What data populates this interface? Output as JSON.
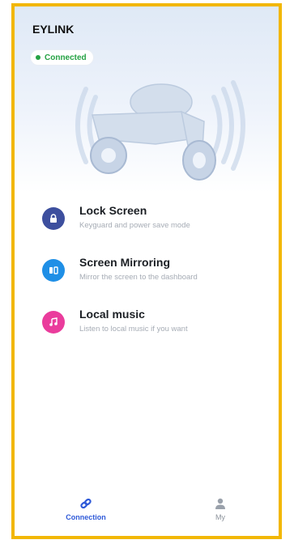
{
  "app": {
    "title": "EYLINK"
  },
  "status": {
    "label": "Connected",
    "color": "#25a244"
  },
  "features": [
    {
      "title": "Lock Screen",
      "subtitle": "Keyguard and power save mode",
      "icon": "lock-icon",
      "color": "#3d4f9e"
    },
    {
      "title": "Screen Mirroring",
      "subtitle": "Mirror the screen to the dashboard",
      "icon": "mirror-icon",
      "color": "#1f8fe6"
    },
    {
      "title": "Local music",
      "subtitle": "Listen to local music if you want",
      "icon": "music-note-icon",
      "color": "#ea3c9c"
    }
  ],
  "nav": {
    "items": [
      {
        "label": "Connection",
        "icon": "link-icon",
        "active": true
      },
      {
        "label": "My",
        "icon": "user-icon",
        "active": false
      }
    ],
    "active_color": "#2f5ad8",
    "inactive_color": "#8c929b"
  },
  "frame_color": "#f2b705"
}
